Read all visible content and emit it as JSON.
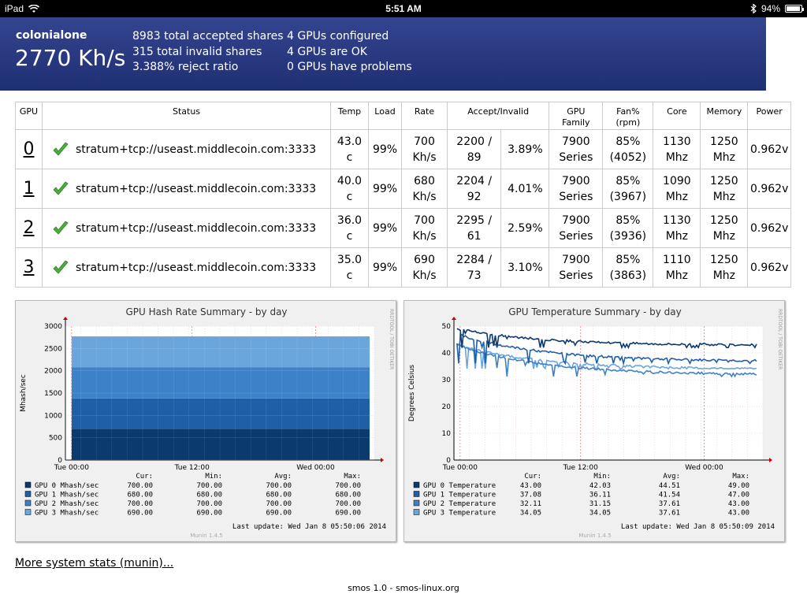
{
  "statusbar": {
    "device": "iPad",
    "time": "5:51 AM",
    "battery": "94%",
    "battery_level": 0.94
  },
  "summary": {
    "hostname": "colonialone",
    "hashrate": "2770 Kh/s",
    "accepted": "8983 total accepted shares",
    "invalid": "315 total invalid shares",
    "reject": "3.388% reject ratio",
    "configured": "4 GPUs configured",
    "ok": "4 GPUs are OK",
    "problems": "0 GPUs have problems"
  },
  "table": {
    "headers": {
      "gpu": "GPU",
      "status": "Status",
      "temp": "Temp",
      "load": "Load",
      "rate": "Rate",
      "accept": "Accept/Invalid",
      "family": "GPU Family",
      "fan": "Fan% (rpm)",
      "core": "Core",
      "memory": "Memory",
      "power": "Power"
    },
    "rows": [
      {
        "id": "0",
        "status": "stratum+tcp://useast.middlecoin.com:3333",
        "temp": "43.0 c",
        "load": "99%",
        "rate": "700 Kh/s",
        "shares": "2200 / 89",
        "pct": "3.89%",
        "family": "7900 Series",
        "fan": "85% (4052)",
        "core": "1130 Mhz",
        "memory": "1250 Mhz",
        "power": "0.962v"
      },
      {
        "id": "1",
        "status": "stratum+tcp://useast.middlecoin.com:3333",
        "temp": "40.0 c",
        "load": "99%",
        "rate": "680 Kh/s",
        "shares": "2204 / 92",
        "pct": "4.01%",
        "family": "7900 Series",
        "fan": "85% (3967)",
        "core": "1090 Mhz",
        "memory": "1250 Mhz",
        "power": "0.962v"
      },
      {
        "id": "2",
        "status": "stratum+tcp://useast.middlecoin.com:3333",
        "temp": "36.0 c",
        "load": "99%",
        "rate": "700 Kh/s",
        "shares": "2295 / 61",
        "pct": "2.59%",
        "family": "7900 Series",
        "fan": "85% (3936)",
        "core": "1130 Mhz",
        "memory": "1250 Mhz",
        "power": "0.962v"
      },
      {
        "id": "3",
        "status": "stratum+tcp://useast.middlecoin.com:3333",
        "temp": "35.0 c",
        "load": "99%",
        "rate": "690 Kh/s",
        "shares": "2284 / 73",
        "pct": "3.10%",
        "family": "7900 Series",
        "fan": "85% (3863)",
        "core": "1110 Mhz",
        "memory": "1250 Mhz",
        "power": "0.962v"
      }
    ]
  },
  "chart_data": [
    {
      "type": "area",
      "title": "GPU Hash Rate Summary - by day",
      "ylabel": "Mhash/sec",
      "ylim": [
        0,
        3000
      ],
      "yticks": [
        "0",
        "500",
        "1000",
        "1500",
        "2000",
        "2500",
        "3000"
      ],
      "xticks": [
        "Tue 00:00",
        "Tue 12:00",
        "Wed 00:00"
      ],
      "stacked": true,
      "side_label": "RRDTOOL / TOBI OETIKER",
      "series": [
        {
          "name": "GPU 0 Mhash/sec",
          "color": "#0b3a6e",
          "values": [
            700,
            700
          ]
        },
        {
          "name": "GPU 1 Mhash/sec",
          "color": "#1f5fa8",
          "values": [
            680,
            680
          ]
        },
        {
          "name": "GPU 2 Mhash/sec",
          "color": "#3d82c9",
          "values": [
            700,
            700
          ]
        },
        {
          "name": "GPU 3 Mhash/sec",
          "color": "#6aa6dc",
          "values": [
            690,
            690
          ]
        }
      ],
      "legend_headers": [
        "Cur:",
        "Min:",
        "Avg:",
        "Max:"
      ],
      "legend_rows": [
        [
          "700.00",
          "700.00",
          "700.00",
          "700.00"
        ],
        [
          "680.00",
          "680.00",
          "680.00",
          "680.00"
        ],
        [
          "700.00",
          "700.00",
          "700.00",
          "700.00"
        ],
        [
          "690.00",
          "690.00",
          "690.00",
          "690.00"
        ]
      ],
      "last_update": "Last update:  Wed Jan  8 05:50:06 2014",
      "footer": "Munin 1.4.5"
    },
    {
      "type": "line",
      "title": "GPU Temperature Summary - by day",
      "ylabel": "Degrees Celsius",
      "ylim": [
        0,
        50
      ],
      "yticks": [
        "0",
        "10",
        "20",
        "30",
        "40",
        "50"
      ],
      "xticks": [
        "Tue 00:00",
        "Tue 12:00",
        "Wed 00:00"
      ],
      "side_label": "RRDTOOL / TOBI OETIKER",
      "series": [
        {
          "name": "GPU 0 Temperature",
          "color": "#0b3a6e",
          "start": 49.0,
          "end": 43.0,
          "low": 42.0
        },
        {
          "name": "GPU 1 Temperature",
          "color": "#1f5fa8",
          "start": 47.0,
          "end": 37.1,
          "low": 36.1
        },
        {
          "name": "GPU 2 Temperature",
          "color": "#3d82c9",
          "start": 43.0,
          "end": 32.1,
          "low": 31.2
        },
        {
          "name": "GPU 3 Temperature",
          "color": "#6aa6dc",
          "start": 43.0,
          "end": 34.1,
          "low": 34.1
        }
      ],
      "legend_headers": [
        "Cur:",
        "Min:",
        "Avg:",
        "Max:"
      ],
      "legend_rows": [
        [
          "43.00",
          "42.03",
          "44.51",
          "49.00"
        ],
        [
          "37.08",
          "36.11",
          "41.54",
          "47.00"
        ],
        [
          "32.11",
          "31.15",
          "37.61",
          "43.00"
        ],
        [
          "34.05",
          "34.05",
          "37.61",
          "43.00"
        ]
      ],
      "last_update": "Last update:  Wed Jan  8 05:50:09 2014",
      "footer": "Munin 1.4.5"
    }
  ],
  "links": {
    "munin": "More system stats (munin)..."
  },
  "footer": "smos 1.0 - smos-linux.org"
}
